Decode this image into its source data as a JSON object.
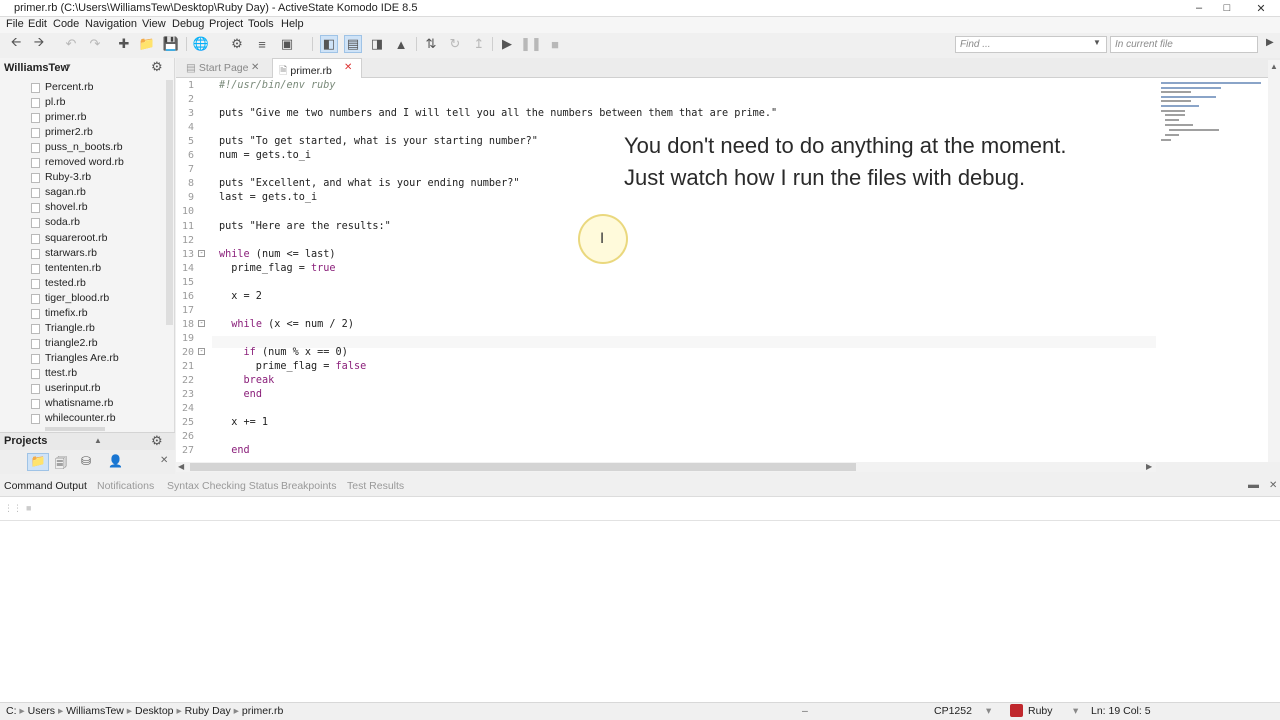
{
  "window": {
    "title": "primer.rb (C:\\Users\\WilliamsTew\\Desktop\\Ruby Day) - ActiveState Komodo IDE 8.5"
  },
  "menu": [
    "File",
    "Edit",
    "Code",
    "Navigation",
    "View",
    "Debug",
    "Project",
    "Tools",
    "Help"
  ],
  "search": {
    "find_placeholder": "Find ...",
    "scope_placeholder": "In current file"
  },
  "places": {
    "title": "WilliamsTew",
    "files": [
      "Percent.rb",
      "pl.rb",
      "primer.rb",
      "primer2.rb",
      "puss_n_boots.rb",
      "removed word.rb",
      "Ruby-3.rb",
      "sagan.rb",
      "shovel.rb",
      "soda.rb",
      "squareroot.rb",
      "starwars.rb",
      "tententen.rb",
      "tested.rb",
      "tiger_blood.rb",
      "timefix.rb",
      "Triangle.rb",
      "triangle2.rb",
      "Triangles Are.rb",
      "ttest.rb",
      "userinput.rb",
      "whatisname.rb",
      "whilecounter.rb"
    ]
  },
  "projects": {
    "title": "Projects"
  },
  "tabs": [
    {
      "label": "Start Page"
    },
    {
      "label": "primer.rb"
    }
  ],
  "code_lines": [
    {
      "n": "1",
      "text": "#!/usr/bin/env ruby"
    },
    {
      "n": "2",
      "text": ""
    },
    {
      "n": "3",
      "text": "puts \"Give me two numbers and I will tell you all the numbers between them that are prime.\""
    },
    {
      "n": "4",
      "text": ""
    },
    {
      "n": "5",
      "text": "puts \"To get started, what is your starting number?\""
    },
    {
      "n": "6",
      "text": "num = gets.to_i"
    },
    {
      "n": "7",
      "text": ""
    },
    {
      "n": "8",
      "text": "puts \"Excellent, and what is your ending number?\""
    },
    {
      "n": "9",
      "text": "last = gets.to_i"
    },
    {
      "n": "10",
      "text": ""
    },
    {
      "n": "11",
      "text": "puts \"Here are the results:\""
    },
    {
      "n": "12",
      "text": ""
    },
    {
      "n": "13",
      "text": "while (num <= last)"
    },
    {
      "n": "14",
      "text": "  prime_flag = true"
    },
    {
      "n": "15",
      "text": ""
    },
    {
      "n": "16",
      "text": "  x = 2"
    },
    {
      "n": "17",
      "text": ""
    },
    {
      "n": "18",
      "text": "  while (x <= num / 2)"
    },
    {
      "n": "19",
      "text": ""
    },
    {
      "n": "20",
      "text": "    if (num % x == 0)"
    },
    {
      "n": "21",
      "text": "      prime_flag = false"
    },
    {
      "n": "22",
      "text": "    break"
    },
    {
      "n": "23",
      "text": "    end"
    },
    {
      "n": "24",
      "text": ""
    },
    {
      "n": "25",
      "text": "  x += 1"
    },
    {
      "n": "26",
      "text": ""
    },
    {
      "n": "27",
      "text": "  end"
    }
  ],
  "overlay": {
    "line1": "You don't need to do anything at the moment.",
    "line2": "Just watch how I run the files with debug."
  },
  "bottom_tabs": [
    "Command Output",
    "Notifications",
    "Syntax Checking Status",
    "Breakpoints",
    "Test Results"
  ],
  "status": {
    "breadcrumb": [
      "C:",
      "Users",
      "WilliamsTew",
      "Desktop",
      "Ruby Day",
      "primer.rb"
    ],
    "encoding": "CP1252",
    "language": "Ruby",
    "position": "Ln: 19 Col: 5"
  },
  "colors": {
    "accent": "#3a7bd5",
    "keyword": "#8a1f7a",
    "string": "#222222"
  }
}
